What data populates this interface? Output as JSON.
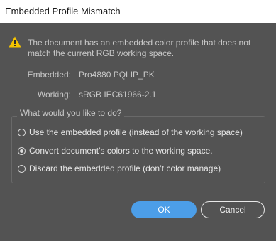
{
  "window": {
    "title": "Embedded Profile Mismatch"
  },
  "message": {
    "icon": "warning-icon",
    "text": "The document has an embedded color profile that does not match the current RGB working space."
  },
  "profiles": {
    "embedded_label": "Embedded:",
    "embedded_value": "Pro4880 PQLIP_PK",
    "working_label": "Working:",
    "working_value": "sRGB IEC61966-2.1"
  },
  "options": {
    "group_label": "What would you like to do?",
    "items": [
      {
        "label": "Use the embedded profile (instead of the working space)",
        "selected": false
      },
      {
        "label": "Convert document’s colors to the working space.",
        "selected": true
      },
      {
        "label": "Discard the embedded profile (don’t color manage)",
        "selected": false
      }
    ]
  },
  "buttons": {
    "ok_label": "OK",
    "cancel_label": "Cancel"
  },
  "colors": {
    "background": "#535353",
    "accent": "#4c9ee8",
    "warning": "#f5c400"
  }
}
